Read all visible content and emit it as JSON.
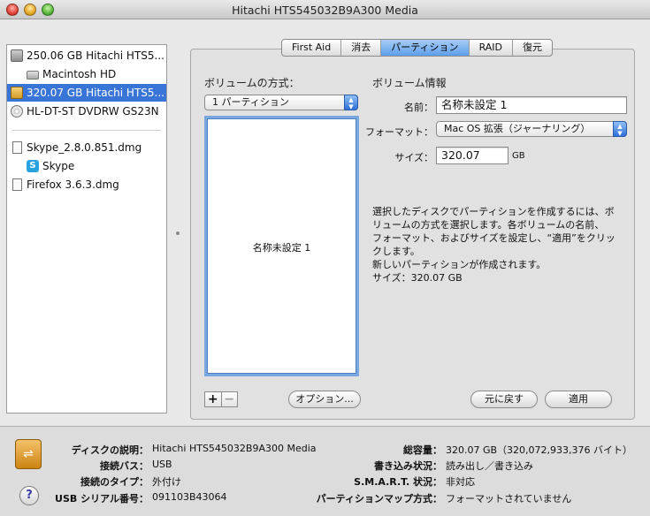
{
  "window": {
    "title": "Hitachi HTS545032B9A300 Media"
  },
  "sidebar": {
    "items": [
      {
        "label": "250.06 GB Hitachi HTS5...",
        "icon": "internal-disk-icon"
      },
      {
        "label": "Macintosh HD",
        "icon": "volume-icon"
      },
      {
        "label": "320.07 GB Hitachi HTS5...",
        "icon": "external-disk-icon",
        "selected": true
      },
      {
        "label": "HL-DT-ST DVDRW GS23N",
        "icon": "optical-drive-icon"
      },
      {
        "label": "Skype_2.8.0.851.dmg",
        "icon": "disk-image-icon"
      },
      {
        "label": "Skype",
        "icon": "skype-icon"
      },
      {
        "label": "Firefox 3.6.3.dmg",
        "icon": "disk-image-icon"
      }
    ]
  },
  "tabs": [
    {
      "label": "First Aid"
    },
    {
      "label": "消去"
    },
    {
      "label": "パーティション",
      "active": true
    },
    {
      "label": "RAID"
    },
    {
      "label": "復元"
    }
  ],
  "partition": {
    "scheme_header": "ボリュームの方式：",
    "scheme_value": "1 パーティション",
    "map_partition_name": "名称未設定 1",
    "add_label": "+",
    "remove_label": "−",
    "options_button": "オプション...",
    "revert_button": "元に戻す",
    "apply_button": "適用"
  },
  "volume_info": {
    "header": "ボリューム情報",
    "name_label": "名前：",
    "name_value": "名称未設定 1",
    "format_label": "フォーマット：",
    "format_value": "Mac OS 拡張（ジャーナリング）",
    "size_label": "サイズ：",
    "size_value": "320.07",
    "size_unit": "GB",
    "description_lines": [
      "選択したディスクでパーティションを作成するには、ボ",
      "リュームの方式を選択します。各ボリュームの名前、",
      "フォーマット、およびサイズを設定し、“適用”をクリッ",
      "クします。"
    ],
    "status_lines": [
      "新しいパーティションが作成されます。",
      "サイズ：320.07 GB"
    ]
  },
  "disk_info": {
    "left": [
      {
        "key": "ディスクの説明：",
        "value": "Hitachi HTS545032B9A300 Media"
      },
      {
        "key": "接続バス：",
        "value": "USB"
      },
      {
        "key": "接続のタイプ：",
        "value": "外付け"
      },
      {
        "key": "USB シリアル番号：",
        "value": "091103B43064"
      }
    ],
    "right": [
      {
        "key": "総容量：",
        "value": "320.07 GB（320,072,933,376 バイト）"
      },
      {
        "key": "書き込み状況：",
        "value": "読み出し／書き込み"
      },
      {
        "key": "S.M.A.R.T. 状況：",
        "value": "非対応"
      },
      {
        "key": "パーティションマップ方式：",
        "value": "フォーマットされていません"
      }
    ],
    "help_label": "?"
  },
  "colors": {
    "selection": "#3875d7",
    "accent_blue": "#5d9ee9"
  }
}
